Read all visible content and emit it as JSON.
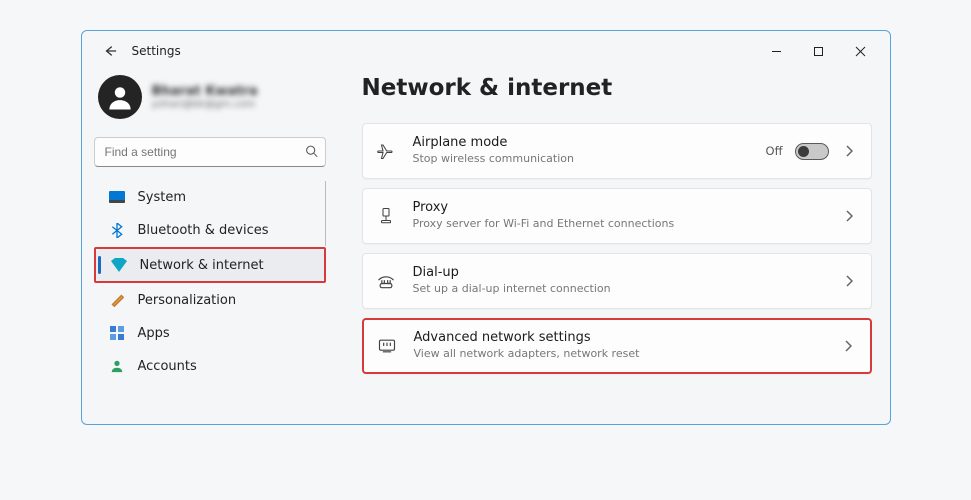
{
  "app_title": "Settings",
  "profile": {
    "name": "Bharat Kwatra",
    "email": "yohan@bk@gm.com"
  },
  "search": {
    "placeholder": "Find a setting"
  },
  "sidebar": {
    "items": [
      {
        "label": "System"
      },
      {
        "label": "Bluetooth & devices"
      },
      {
        "label": "Network & internet"
      },
      {
        "label": "Personalization"
      },
      {
        "label": "Apps"
      },
      {
        "label": "Accounts"
      }
    ]
  },
  "page": {
    "title": "Network & internet"
  },
  "cards": {
    "airplane": {
      "title": "Airplane mode",
      "desc": "Stop wireless communication",
      "state": "Off"
    },
    "proxy": {
      "title": "Proxy",
      "desc": "Proxy server for Wi-Fi and Ethernet connections"
    },
    "dialup": {
      "title": "Dial-up",
      "desc": "Set up a dial-up internet connection"
    },
    "advanced": {
      "title": "Advanced network settings",
      "desc": "View all network adapters, network reset"
    }
  }
}
